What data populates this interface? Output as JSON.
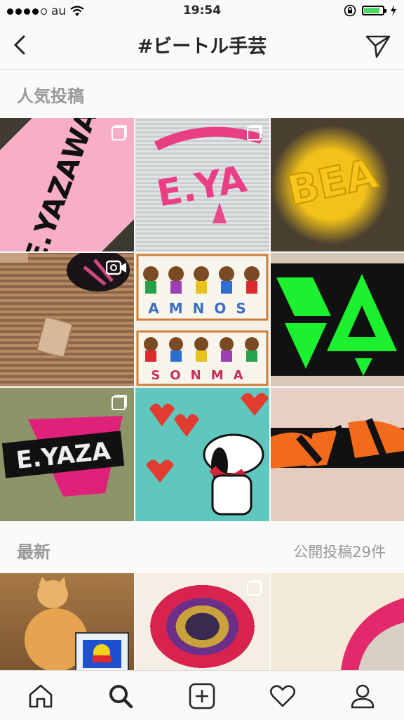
{
  "status": {
    "carrier": "au",
    "time": "19:54",
    "battery_level": 0.8
  },
  "nav": {
    "title": "#ビートル手芸",
    "back_icon": "chevron-left-icon",
    "send_icon": "paper-plane-icon"
  },
  "top_posts": {
    "title": "人気投稿",
    "tiles": [
      {
        "text": "E.YAZAWA",
        "badge": "multiple"
      },
      {
        "text": "E.YA",
        "badge": "multiple"
      },
      {
        "text": "BEA",
        "badge": ""
      },
      {
        "text": "",
        "badge": "video"
      },
      {
        "text_top": "AMNOS",
        "text_bottom": "SONMA",
        "badge": ""
      },
      {
        "text": "",
        "badge": ""
      },
      {
        "text": "E.YAZA",
        "badge": "multiple"
      },
      {
        "text": "",
        "badge": ""
      },
      {
        "text": "",
        "badge": ""
      }
    ]
  },
  "recent": {
    "title": "最新",
    "count_label": "公開投稿29件",
    "tiles": [
      {
        "badge": ""
      },
      {
        "badge": "multiple"
      },
      {
        "badge": ""
      }
    ]
  },
  "tabbar": {
    "items": [
      "home-icon",
      "search-icon",
      "add-post-icon",
      "heart-icon",
      "profile-icon"
    ],
    "active": "search-icon"
  }
}
